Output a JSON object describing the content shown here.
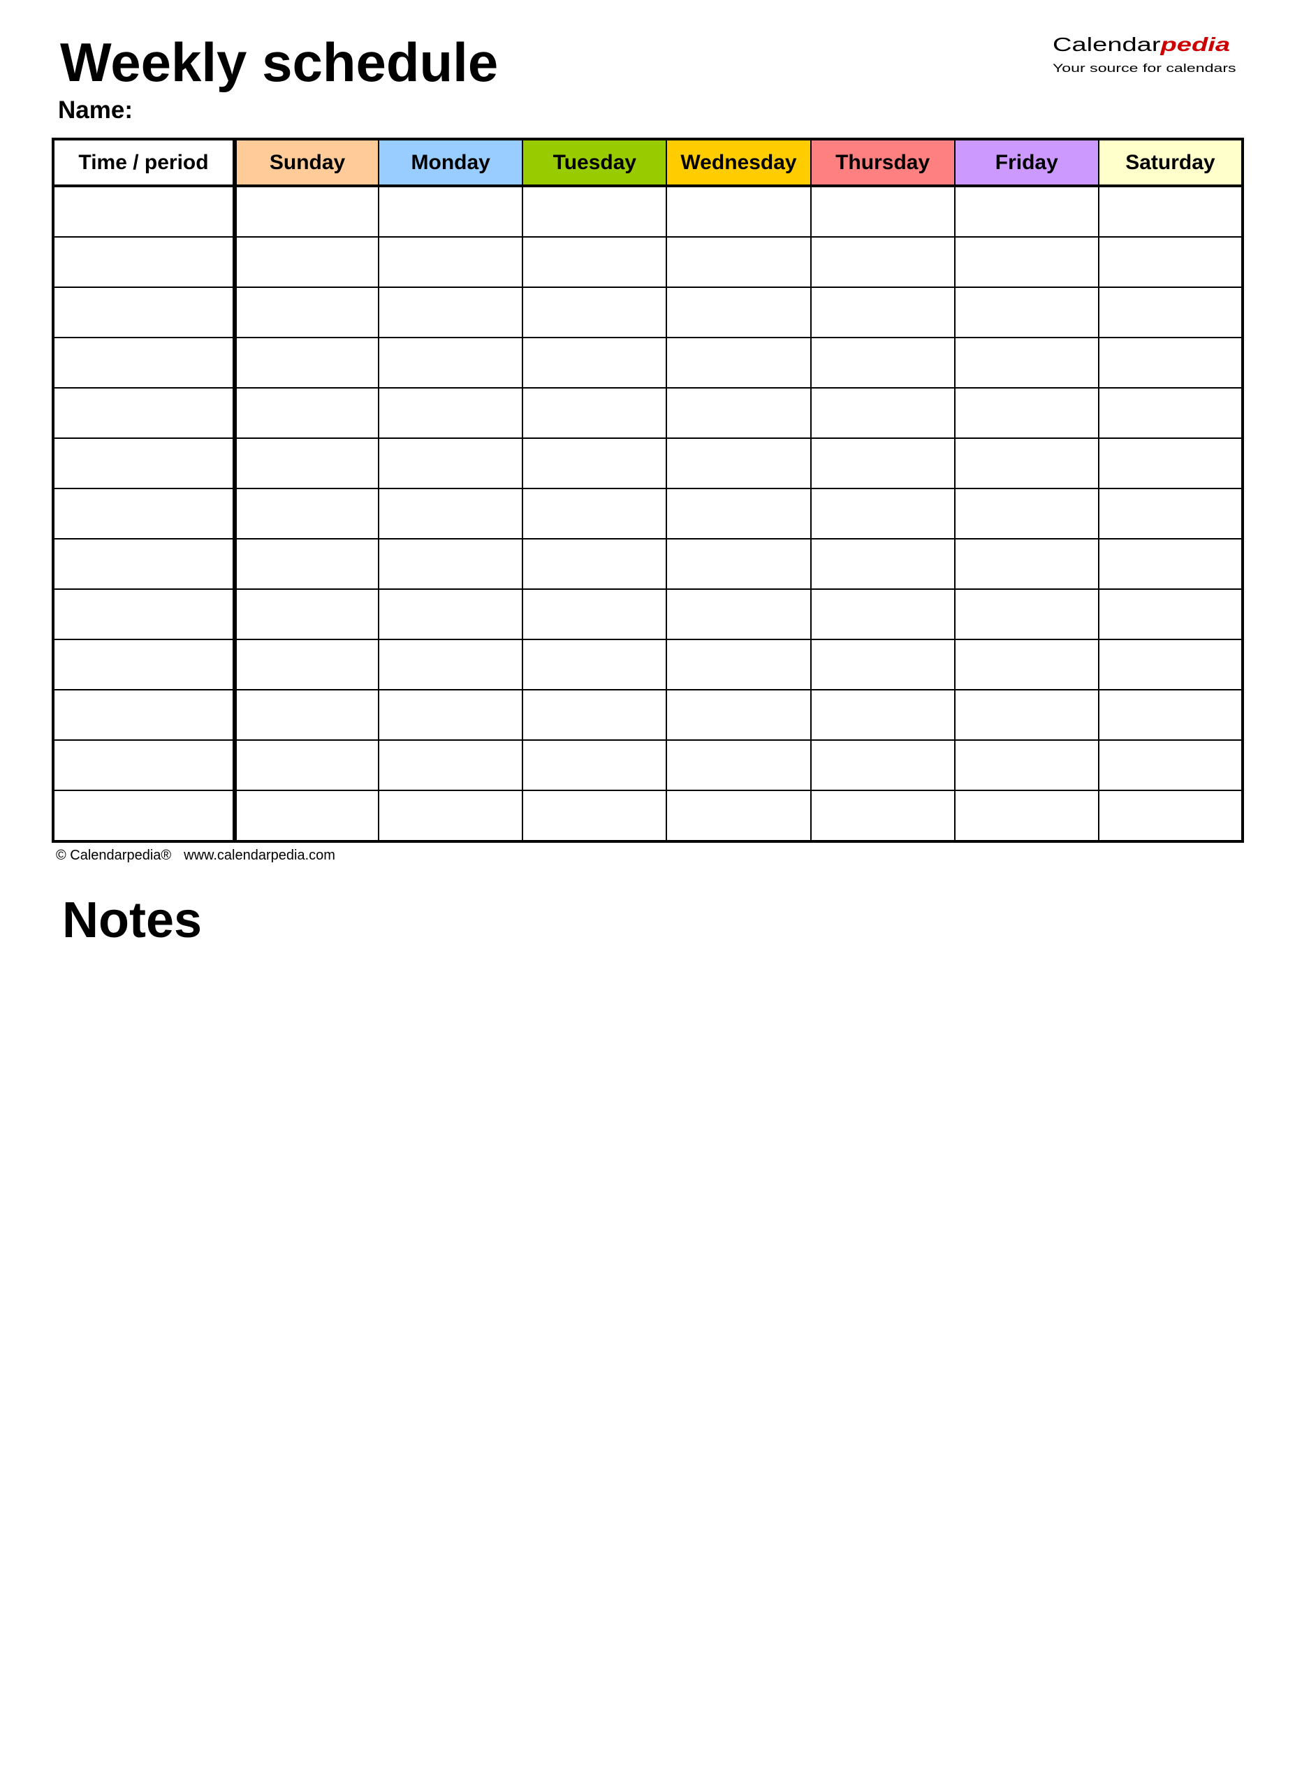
{
  "header": {
    "title": "Weekly schedule",
    "name_label": "Name:",
    "logo": {
      "brand_main": "Calendar",
      "brand_accent": "pedia",
      "tagline": "Your source for calendars",
      "accent_color": "#cc0000"
    }
  },
  "schedule": {
    "time_column_header": "Time / period",
    "days": [
      {
        "label": "Sunday",
        "color": "#FFCC99"
      },
      {
        "label": "Monday",
        "color": "#99CCFF"
      },
      {
        "label": "Tuesday",
        "color": "#99CC00"
      },
      {
        "label": "Wednesday",
        "color": "#FFCC00"
      },
      {
        "label": "Thursday",
        "color": "#FF8080"
      },
      {
        "label": "Friday",
        "color": "#CC99FF"
      },
      {
        "label": "Saturday",
        "color": "#FFFFCC"
      }
    ],
    "rows": [
      {
        "time": "",
        "cells": [
          "",
          "",
          "",
          "",
          "",
          "",
          ""
        ]
      },
      {
        "time": "",
        "cells": [
          "",
          "",
          "",
          "",
          "",
          "",
          ""
        ]
      },
      {
        "time": "",
        "cells": [
          "",
          "",
          "",
          "",
          "",
          "",
          ""
        ]
      },
      {
        "time": "",
        "cells": [
          "",
          "",
          "",
          "",
          "",
          "",
          ""
        ]
      },
      {
        "time": "",
        "cells": [
          "",
          "",
          "",
          "",
          "",
          "",
          ""
        ]
      },
      {
        "time": "",
        "cells": [
          "",
          "",
          "",
          "",
          "",
          "",
          ""
        ]
      },
      {
        "time": "",
        "cells": [
          "",
          "",
          "",
          "",
          "",
          "",
          ""
        ]
      },
      {
        "time": "",
        "cells": [
          "",
          "",
          "",
          "",
          "",
          "",
          ""
        ]
      },
      {
        "time": "",
        "cells": [
          "",
          "",
          "",
          "",
          "",
          "",
          ""
        ]
      },
      {
        "time": "",
        "cells": [
          "",
          "",
          "",
          "",
          "",
          "",
          ""
        ]
      },
      {
        "time": "",
        "cells": [
          "",
          "",
          "",
          "",
          "",
          "",
          ""
        ]
      },
      {
        "time": "",
        "cells": [
          "",
          "",
          "",
          "",
          "",
          "",
          ""
        ]
      },
      {
        "time": "",
        "cells": [
          "",
          "",
          "",
          "",
          "",
          "",
          ""
        ]
      }
    ]
  },
  "footer": {
    "copyright": "© Calendarpedia®",
    "website": "www.calendarpedia.com"
  },
  "notes": {
    "title": "Notes"
  }
}
